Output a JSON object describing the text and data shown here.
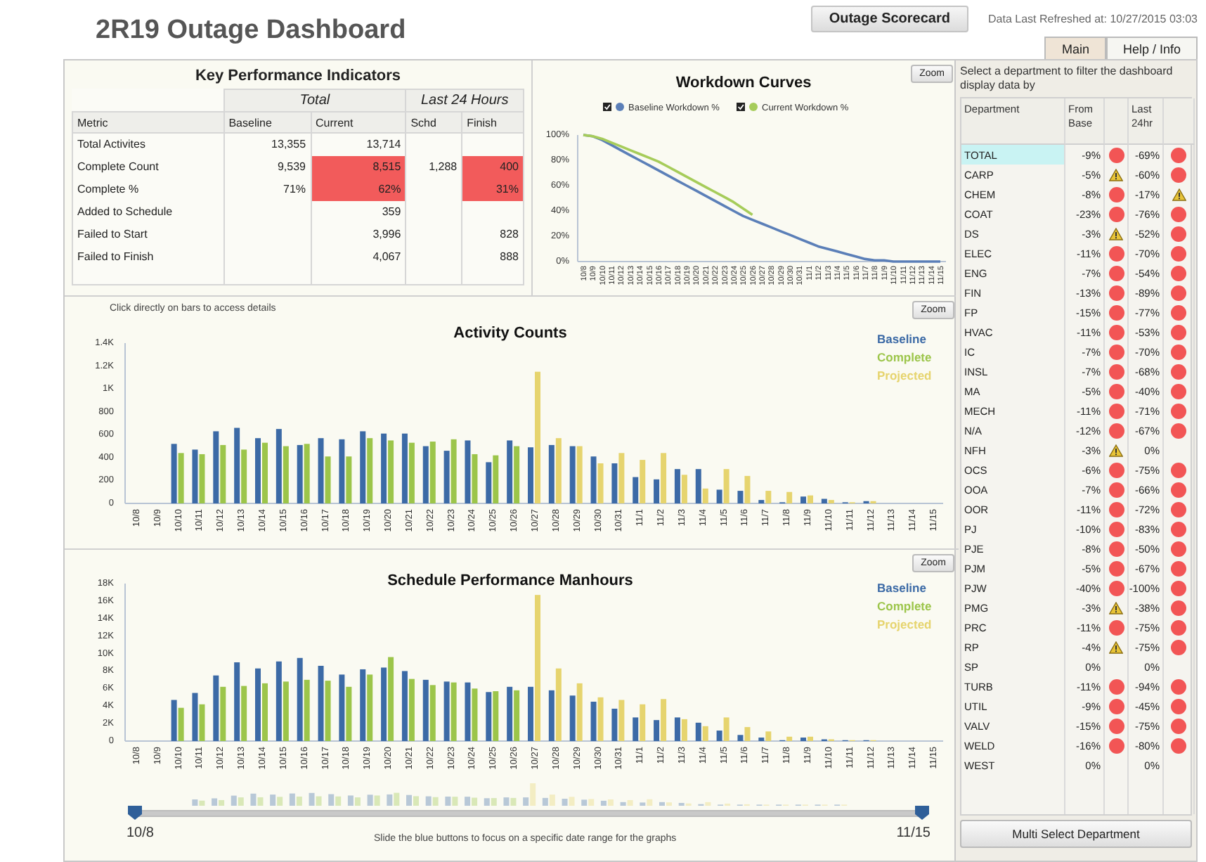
{
  "header": {
    "title": "2R19 Outage Dashboard",
    "scorecard_button": "Outage Scorecard",
    "refreshed": "Data Last Refreshed at: 10/27/2015 03:03",
    "tabs": [
      {
        "label": "Main",
        "selected": true
      },
      {
        "label": "Help / Info",
        "selected": false
      }
    ]
  },
  "kpi": {
    "title": "Key Performance Indicators",
    "groups": [
      "Total",
      "Last 24 Hours"
    ],
    "columns": [
      "Metric",
      "Baseline",
      "Current",
      "Schd",
      "Finish"
    ],
    "rows": [
      {
        "cells": [
          {
            "text": "Total Activites"
          },
          {
            "text": "13,355",
            "alert": false
          },
          {
            "text": "13,714",
            "alert": false
          },
          {
            "text": ""
          },
          {
            "text": ""
          }
        ]
      },
      {
        "cells": [
          {
            "text": "Complete Count"
          },
          {
            "text": "9,539",
            "alert": false
          },
          {
            "text": "8,515",
            "alert": true
          },
          {
            "text": "1,288",
            "alert": false
          },
          {
            "text": "400",
            "alert": true
          }
        ]
      },
      {
        "cells": [
          {
            "text": "Complete %"
          },
          {
            "text": "71%",
            "alert": false
          },
          {
            "text": "62%",
            "alert": true
          },
          {
            "text": ""
          },
          {
            "text": "31%",
            "alert": true
          }
        ]
      },
      {
        "cells": [
          {
            "text": "Added to Schedule"
          },
          {
            "text": ""
          },
          {
            "text": "359",
            "alert": false
          },
          {
            "text": ""
          },
          {
            "text": ""
          }
        ]
      },
      {
        "cells": [
          {
            "text": "Failed to Start"
          },
          {
            "text": ""
          },
          {
            "text": "3,996",
            "alert": false
          },
          {
            "text": ""
          },
          {
            "text": "828",
            "alert": false
          }
        ]
      },
      {
        "cells": [
          {
            "text": "Failed to Finish"
          },
          {
            "text": ""
          },
          {
            "text": "4,067",
            "alert": false
          },
          {
            "text": ""
          },
          {
            "text": "888",
            "alert": false
          }
        ]
      }
    ]
  },
  "workdown": {
    "zoom_button": "Zoom",
    "chart_data": {
      "type": "line",
      "title": "Workdown Curves",
      "legend": "top",
      "categories": [
        "10/8",
        "10/9",
        "10/10",
        "10/11",
        "10/12",
        "10/13",
        "10/14",
        "10/15",
        "10/16",
        "10/17",
        "10/18",
        "10/19",
        "10/20",
        "10/21",
        "10/22",
        "10/23",
        "10/24",
        "10/25",
        "10/26",
        "10/27",
        "10/28",
        "10/29",
        "10/30",
        "10/31",
        "11/1",
        "11/2",
        "11/3",
        "11/4",
        "11/5",
        "11/6",
        "11/7",
        "11/8",
        "11/9",
        "11/10",
        "11/11",
        "11/12",
        "11/13",
        "11/14",
        "11/15"
      ],
      "ylim": [
        0,
        100
      ],
      "yticks": [
        {
          "value": 0,
          "label": "0%"
        },
        {
          "value": 20,
          "label": "20%"
        },
        {
          "value": 40,
          "label": "40%"
        },
        {
          "value": 60,
          "label": "60%"
        },
        {
          "value": 80,
          "label": "80%"
        },
        {
          "value": 100,
          "label": "100%"
        }
      ],
      "series": [
        {
          "name": "Baseline Workdown %",
          "color": "#5b7fb8",
          "values": [
            100,
            99,
            96,
            92,
            88,
            84,
            80,
            76,
            72,
            68,
            64,
            60,
            56,
            52,
            48,
            44,
            40,
            36,
            33,
            30,
            27,
            24,
            21,
            18,
            15,
            12,
            10,
            8,
            6,
            4,
            2,
            1,
            1,
            0,
            0,
            0,
            0,
            0,
            0
          ]
        },
        {
          "name": "Current Workdown %",
          "color": "#a6cc5a",
          "values": [
            100,
            99,
            97,
            94,
            91,
            88,
            85,
            82,
            79,
            75,
            71,
            67,
            63,
            59,
            55,
            51,
            47,
            42,
            37,
            null,
            null,
            null,
            null,
            null,
            null,
            null,
            null,
            null,
            null,
            null,
            null,
            null,
            null,
            null,
            null,
            null,
            null,
            null,
            null
          ]
        }
      ]
    }
  },
  "activity": {
    "note": "Click directly on bars to access details",
    "zoom_button": "Zoom",
    "chart_data": {
      "type": "bar",
      "title": "Activity Counts",
      "legend": "right",
      "categories": [
        "10/8",
        "10/9",
        "10/10",
        "10/11",
        "10/12",
        "10/13",
        "10/14",
        "10/15",
        "10/16",
        "10/17",
        "10/18",
        "10/19",
        "10/20",
        "10/21",
        "10/22",
        "10/23",
        "10/24",
        "10/25",
        "10/26",
        "10/27",
        "10/28",
        "10/29",
        "10/30",
        "10/31",
        "11/1",
        "11/2",
        "11/3",
        "11/4",
        "11/5",
        "11/6",
        "11/7",
        "11/8",
        "11/9",
        "11/10",
        "11/11",
        "11/12",
        "11/13",
        "11/14",
        "11/15"
      ],
      "ylim": [
        0,
        1400
      ],
      "yticks": [
        0,
        200,
        400,
        600,
        800,
        {
          "value": 1000,
          "label": "1K"
        },
        {
          "value": 1200,
          "label": "1.2K"
        },
        {
          "value": 1400,
          "label": "1.4K"
        }
      ],
      "series": [
        {
          "name": "Baseline",
          "color": "#3c6aa6",
          "values": [
            null,
            null,
            520,
            470,
            630,
            660,
            570,
            650,
            510,
            570,
            560,
            630,
            610,
            610,
            500,
            460,
            550,
            360,
            550,
            490,
            510,
            500,
            410,
            350,
            230,
            210,
            300,
            300,
            120,
            110,
            30,
            10,
            60,
            40,
            10,
            20,
            null,
            null,
            null
          ]
        },
        {
          "name": "Complete",
          "color": "#9cc54a",
          "values": [
            null,
            null,
            440,
            430,
            510,
            470,
            530,
            500,
            520,
            410,
            410,
            570,
            550,
            530,
            540,
            560,
            430,
            420,
            500,
            null,
            null,
            null,
            null,
            null,
            null,
            null,
            null,
            null,
            null,
            null,
            null,
            null,
            null,
            null,
            null,
            null,
            null,
            null,
            null
          ]
        },
        {
          "name": "Projected",
          "color": "#e6d46e",
          "values": [
            null,
            null,
            null,
            null,
            null,
            null,
            null,
            null,
            null,
            null,
            null,
            null,
            null,
            null,
            null,
            null,
            null,
            null,
            null,
            1150,
            570,
            500,
            350,
            440,
            380,
            440,
            250,
            130,
            300,
            240,
            110,
            100,
            70,
            30,
            10,
            20,
            null,
            null,
            null
          ]
        }
      ]
    }
  },
  "manhours": {
    "zoom_button": "Zoom",
    "chart_data": {
      "type": "bar",
      "title": "Schedule Performance Manhours",
      "legend": "right",
      "categories": [
        "10/8",
        "10/9",
        "10/10",
        "10/11",
        "10/12",
        "10/13",
        "10/14",
        "10/15",
        "10/16",
        "10/17",
        "10/18",
        "10/19",
        "10/20",
        "10/21",
        "10/22",
        "10/23",
        "10/24",
        "10/25",
        "10/26",
        "10/27",
        "10/28",
        "10/29",
        "10/30",
        "10/31",
        "11/1",
        "11/2",
        "11/3",
        "11/4",
        "11/5",
        "11/6",
        "11/7",
        "11/8",
        "11/9",
        "11/10",
        "11/11",
        "11/12",
        "11/13",
        "11/14",
        "11/15"
      ],
      "ylim": [
        0,
        18000
      ],
      "yticks": [
        0,
        {
          "value": 2000,
          "label": "2K"
        },
        {
          "value": 4000,
          "label": "4K"
        },
        {
          "value": 6000,
          "label": "6K"
        },
        {
          "value": 8000,
          "label": "8K"
        },
        {
          "value": 10000,
          "label": "10K"
        },
        {
          "value": 12000,
          "label": "12K"
        },
        {
          "value": 14000,
          "label": "14K"
        },
        {
          "value": 16000,
          "label": "16K"
        },
        {
          "value": 18000,
          "label": "18K"
        }
      ],
      "series": [
        {
          "name": "Baseline",
          "color": "#3c6aa6",
          "values": [
            null,
            null,
            4700,
            5500,
            7500,
            9000,
            8300,
            9100,
            9500,
            8600,
            7600,
            8200,
            8400,
            8000,
            7000,
            6800,
            6700,
            5600,
            6200,
            6200,
            5800,
            5200,
            4500,
            3700,
            2700,
            2400,
            2700,
            2100,
            1200,
            700,
            400,
            100,
            400,
            200,
            100,
            100,
            null,
            null,
            null
          ]
        },
        {
          "name": "Complete",
          "color": "#9cc54a",
          "values": [
            null,
            null,
            3800,
            4200,
            6200,
            6300,
            6600,
            6800,
            7000,
            6900,
            6200,
            7600,
            9600,
            7100,
            6400,
            6700,
            6000,
            5700,
            5800,
            null,
            null,
            null,
            null,
            null,
            null,
            null,
            null,
            null,
            null,
            null,
            null,
            null,
            null,
            null,
            null,
            null,
            null,
            null,
            null
          ]
        },
        {
          "name": "Projected",
          "color": "#e6d46e",
          "values": [
            null,
            null,
            null,
            null,
            null,
            null,
            null,
            null,
            null,
            null,
            null,
            null,
            null,
            null,
            null,
            null,
            null,
            null,
            null,
            16700,
            8300,
            6600,
            5000,
            4700,
            4200,
            4800,
            2500,
            1700,
            2700,
            1600,
            1100,
            500,
            500,
            200,
            100,
            100,
            null,
            null,
            null
          ]
        }
      ]
    },
    "range": {
      "start": "10/8",
      "end": "11/15",
      "hint": "Slide the blue buttons to focus on a specific date range for the graphs",
      "level": 1
    }
  },
  "departments": {
    "instruction": "Select a department to filter the dashboard display data by",
    "columns": [
      "Department",
      "From Base",
      "Last 24hr"
    ],
    "rows": [
      {
        "name": "TOTAL",
        "selected": true,
        "from_base": "-9%",
        "base_status": {
          "kind": "alert"
        },
        "last_24hr": "-69%",
        "day_status": {
          "kind": "alert"
        }
      },
      {
        "name": "CARP",
        "selected": false,
        "from_base": "-5%",
        "base_status": {
          "kind": "warning"
        },
        "last_24hr": "-60%",
        "day_status": {
          "kind": "alert"
        }
      },
      {
        "name": "CHEM",
        "selected": false,
        "from_base": "-8%",
        "base_status": {
          "kind": "alert"
        },
        "last_24hr": "-17%",
        "day_status": {
          "kind": "warning"
        }
      },
      {
        "name": "COAT",
        "selected": false,
        "from_base": "-23%",
        "base_status": {
          "kind": "alert"
        },
        "last_24hr": "-76%",
        "day_status": {
          "kind": "alert"
        }
      },
      {
        "name": "DS",
        "selected": false,
        "from_base": "-3%",
        "base_status": {
          "kind": "warning"
        },
        "last_24hr": "-52%",
        "day_status": {
          "kind": "alert"
        }
      },
      {
        "name": "ELEC",
        "selected": false,
        "from_base": "-11%",
        "base_status": {
          "kind": "alert"
        },
        "last_24hr": "-70%",
        "day_status": {
          "kind": "alert"
        }
      },
      {
        "name": "ENG",
        "selected": false,
        "from_base": "-7%",
        "base_status": {
          "kind": "alert"
        },
        "last_24hr": "-54%",
        "day_status": {
          "kind": "alert"
        }
      },
      {
        "name": "FIN",
        "selected": false,
        "from_base": "-13%",
        "base_status": {
          "kind": "alert"
        },
        "last_24hr": "-89%",
        "day_status": {
          "kind": "alert"
        }
      },
      {
        "name": "FP",
        "selected": false,
        "from_base": "-15%",
        "base_status": {
          "kind": "alert"
        },
        "last_24hr": "-77%",
        "day_status": {
          "kind": "alert"
        }
      },
      {
        "name": "HVAC",
        "selected": false,
        "from_base": "-11%",
        "base_status": {
          "kind": "alert"
        },
        "last_24hr": "-53%",
        "day_status": {
          "kind": "alert"
        }
      },
      {
        "name": "IC",
        "selected": false,
        "from_base": "-7%",
        "base_status": {
          "kind": "alert"
        },
        "last_24hr": "-70%",
        "day_status": {
          "kind": "alert"
        }
      },
      {
        "name": "INSL",
        "selected": false,
        "from_base": "-7%",
        "base_status": {
          "kind": "alert"
        },
        "last_24hr": "-68%",
        "day_status": {
          "kind": "alert"
        }
      },
      {
        "name": "MA",
        "selected": false,
        "from_base": "-5%",
        "base_status": {
          "kind": "alert"
        },
        "last_24hr": "-40%",
        "day_status": {
          "kind": "alert"
        }
      },
      {
        "name": "MECH",
        "selected": false,
        "from_base": "-11%",
        "base_status": {
          "kind": "alert"
        },
        "last_24hr": "-71%",
        "day_status": {
          "kind": "alert"
        }
      },
      {
        "name": "N/A",
        "selected": false,
        "from_base": "-12%",
        "base_status": {
          "kind": "alert"
        },
        "last_24hr": "-67%",
        "day_status": {
          "kind": "alert"
        }
      },
      {
        "name": "NFH",
        "selected": false,
        "from_base": "-3%",
        "base_status": {
          "kind": "warning"
        },
        "last_24hr": "0%"
      },
      {
        "name": "OCS",
        "selected": false,
        "from_base": "-6%",
        "base_status": {
          "kind": "alert"
        },
        "last_24hr": "-75%",
        "day_status": {
          "kind": "alert"
        }
      },
      {
        "name": "OOA",
        "selected": false,
        "from_base": "-7%",
        "base_status": {
          "kind": "alert"
        },
        "last_24hr": "-66%",
        "day_status": {
          "kind": "alert"
        }
      },
      {
        "name": "OOR",
        "selected": false,
        "from_base": "-11%",
        "base_status": {
          "kind": "alert"
        },
        "last_24hr": "-72%",
        "day_status": {
          "kind": "alert"
        }
      },
      {
        "name": "PJ",
        "selected": false,
        "from_base": "-10%",
        "base_status": {
          "kind": "alert"
        },
        "last_24hr": "-83%",
        "day_status": {
          "kind": "alert"
        }
      },
      {
        "name": "PJE",
        "selected": false,
        "from_base": "-8%",
        "base_status": {
          "kind": "alert"
        },
        "last_24hr": "-50%",
        "day_status": {
          "kind": "alert"
        }
      },
      {
        "name": "PJM",
        "selected": false,
        "from_base": "-5%",
        "base_status": {
          "kind": "alert"
        },
        "last_24hr": "-67%",
        "day_status": {
          "kind": "alert"
        }
      },
      {
        "name": "PJW",
        "selected": false,
        "from_base": "-40%",
        "base_status": {
          "kind": "alert"
        },
        "last_24hr": "-100%",
        "day_status": {
          "kind": "alert"
        }
      },
      {
        "name": "PMG",
        "selected": false,
        "from_base": "-3%",
        "base_status": {
          "kind": "warning"
        },
        "last_24hr": "-38%",
        "day_status": {
          "kind": "alert"
        }
      },
      {
        "name": "PRC",
        "selected": false,
        "from_base": "-11%",
        "base_status": {
          "kind": "alert"
        },
        "last_24hr": "-75%",
        "day_status": {
          "kind": "alert"
        }
      },
      {
        "name": "RP",
        "selected": false,
        "from_base": "-4%",
        "base_status": {
          "kind": "warning"
        },
        "last_24hr": "-75%",
        "day_status": {
          "kind": "alert"
        }
      },
      {
        "name": "SP",
        "selected": false,
        "from_base": "0%",
        "last_24hr": "0%"
      },
      {
        "name": "TURB",
        "selected": false,
        "from_base": "-11%",
        "base_status": {
          "kind": "alert"
        },
        "last_24hr": "-94%",
        "day_status": {
          "kind": "alert"
        }
      },
      {
        "name": "UTIL",
        "selected": false,
        "from_base": "-9%",
        "base_status": {
          "kind": "alert"
        },
        "last_24hr": "-45%",
        "day_status": {
          "kind": "alert"
        }
      },
      {
        "name": "VALV",
        "selected": false,
        "from_base": "-15%",
        "base_status": {
          "kind": "alert"
        },
        "last_24hr": "-75%",
        "day_status": {
          "kind": "alert"
        }
      },
      {
        "name": "WELD",
        "selected": false,
        "from_base": "-16%",
        "base_status": {
          "kind": "alert"
        },
        "last_24hr": "-80%",
        "day_status": {
          "kind": "alert"
        }
      },
      {
        "name": "WEST",
        "selected": false,
        "from_base": "0%",
        "last_24hr": "0%"
      }
    ],
    "multi_select_button": "Multi Select Department"
  }
}
